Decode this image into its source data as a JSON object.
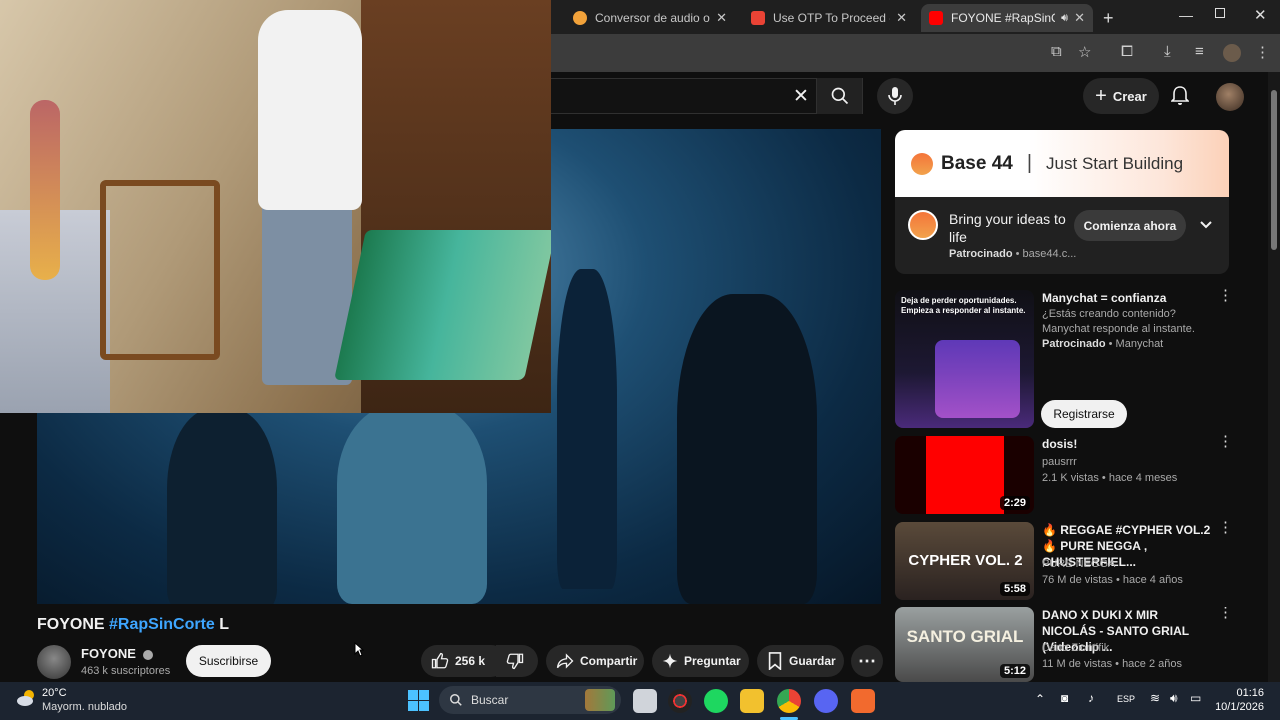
{
  "browser": {
    "tabs": [
      {
        "title": "Conversor de audio online",
        "favicon_color": "#f2a23a",
        "active": false
      },
      {
        "title": "Use OTP To Proceed - alejo",
        "favicon_color": "#ea4335",
        "active": false
      },
      {
        "title": "FOYONE #RapSinCorte",
        "favicon_color": "#ff0000",
        "active": true
      }
    ],
    "new_tab": "+"
  },
  "youtube": {
    "header": {
      "create_label": "Crear"
    },
    "video": {
      "title_prefix": "FOYONE",
      "title_hashtag": "#RapSinCorte",
      "title_suffix": "L"
    },
    "channel": {
      "name": "FOYONE",
      "subscribers": "463 k suscriptores",
      "subscribe_label": "Suscribirse"
    },
    "actions": {
      "likes": "256 k",
      "share": "Compartir",
      "ask": "Preguntar",
      "save": "Guardar"
    },
    "ad": {
      "brand": "Base 44",
      "separator": "|",
      "slogan": "Just Start Building",
      "headline": "Bring your ideas to life",
      "sponsored": "Patrocinado",
      "domain": "base44.c...",
      "cta": "Comienza ahora"
    },
    "recommendations": [
      {
        "title": "Manychat = confianza",
        "description": "¿Estás creando contenido? Manychat responde al instante.",
        "sponsored": "Patrocinado",
        "advertiser": "Manychat",
        "cta": "Registrarse",
        "thumb_text": "Deja de perder oportunidades. Empieza a responder al instante."
      },
      {
        "title": "dosis!",
        "channel": "pausrrr",
        "meta": "2.1 K vistas • hace 4 meses",
        "duration": "2:29"
      },
      {
        "title": "🔥 REGGAE #CYPHER VOL.2🔥 PURE NEGGA , CHUSTERFIEL...",
        "channel": "PURE NEGGA",
        "meta": "76 M de vistas • hace 4 años",
        "duration": "5:58",
        "thumb_text": "CYPHER VOL. 2"
      },
      {
        "title": "DANO X DUKI X MIR NICOLÁS - SANTO GRIAL (Videoclip ...",
        "channel": "Dano Ziontifik",
        "meta": "11 M de vistas • hace 2 años",
        "duration": "5:12",
        "thumb_text": "SANTO GRIAL"
      }
    ]
  },
  "taskbar": {
    "temperature": "20°C",
    "weather": "Mayorm. nublado",
    "search_placeholder": "Buscar",
    "language": "ESP",
    "time": "01:16",
    "date": "10/1/2026"
  }
}
